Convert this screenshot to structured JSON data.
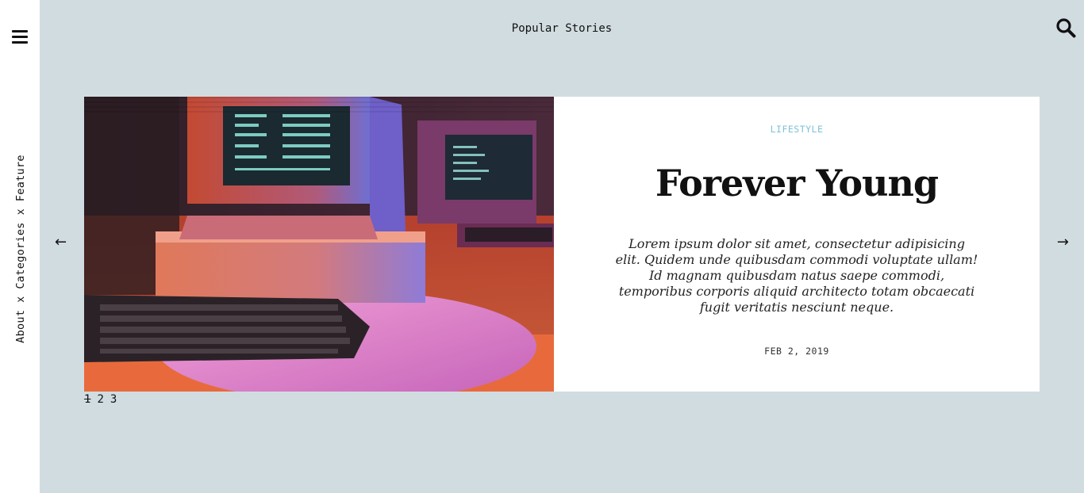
{
  "sidebar": {
    "menu_icon": "hamburger-menu-icon",
    "nav": [
      {
        "label": "About"
      },
      {
        "label": "Categories"
      },
      {
        "label": "Feature"
      }
    ],
    "separator": "x"
  },
  "header": {
    "title": "Popular Stories",
    "search_icon": "search-icon"
  },
  "carousel": {
    "prev_arrow": "←",
    "next_arrow": "→",
    "slide": {
      "image_alt": "retro computers",
      "category": "LIFESTYLE",
      "title": "Forever Young",
      "excerpt": "Lorem ipsum dolor sit amet, consectetur adipisicing elit. Quidem unde quibusdam commodi voluptate ullam! Id magnam quibusdam natus saepe commodi, temporibus corporis aliquid architecto totam obcaecati fugit veritatis nesciunt neque.",
      "date": "FEB 2, 2019"
    },
    "pages": [
      "1",
      "2",
      "3"
    ],
    "active_page": "1"
  },
  "colors": {
    "main_bg": "#d1dce1",
    "category": "#7fc1d6"
  }
}
